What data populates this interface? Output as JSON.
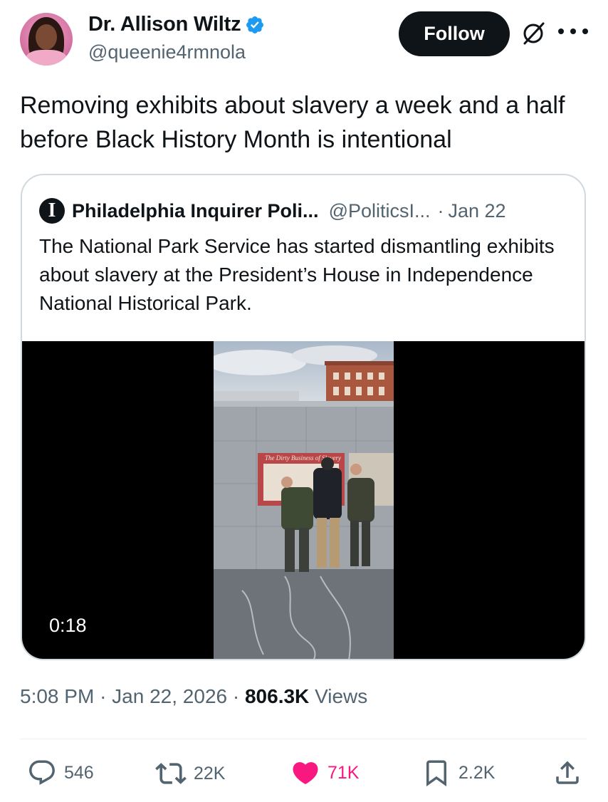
{
  "author": {
    "display_name": "Dr. Allison Wiltz",
    "handle": "@queenie4rmnola",
    "verified_icon": "verified-badge-icon"
  },
  "header": {
    "follow_label": "Follow",
    "grok_icon": "grok-icon",
    "more_icon": "more-options-icon"
  },
  "tweet": {
    "text": "Removing exhibits about slavery a week and a half before Black History Month is intentional"
  },
  "quote": {
    "name": "Philadelphia Inquirer Poli...",
    "handle": "@PoliticsI...",
    "separator": "·",
    "date": "Jan 22",
    "text": "The National Park Service has started dismantling exhibits about slavery at the President’s House in Independence National Historical Park.",
    "video": {
      "duration": "0:18",
      "sign_text": "The Dirty Business of Slavery"
    }
  },
  "meta": {
    "time": "5:08 PM",
    "sep1": "·",
    "date": "Jan 22, 2026",
    "sep2": "·",
    "views_count": "806.3K",
    "views_label": "Views"
  },
  "actions": {
    "replies": "546",
    "reposts": "22K",
    "likes": "71K",
    "bookmarks": "2.2K"
  },
  "colors": {
    "text": "#0f1419",
    "secondary": "#536471",
    "verified": "#1d9bf0",
    "like": "#f91880",
    "border": "#cfd9de"
  }
}
